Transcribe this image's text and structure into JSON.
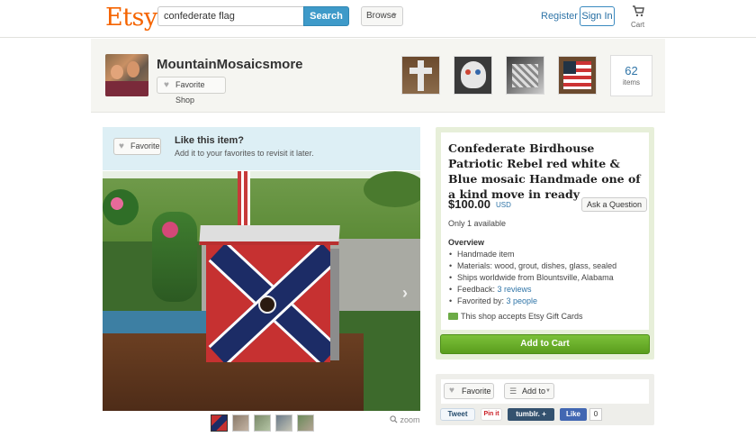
{
  "header": {
    "logo": "Etsy",
    "search_value": "confederate flag",
    "search_button": "Search",
    "browse_label": "Browse",
    "register": "Register",
    "signin": "Sign In",
    "cart_label": "Cart"
  },
  "shop": {
    "name": "MountainMosaicsmore",
    "favorite_shop": "Favorite Shop",
    "items_count": "62",
    "items_label": "items"
  },
  "favorite_prompt": {
    "button": "Favorite",
    "title": "Like this item?",
    "subtitle": "Add it to your favorites to revisit it later."
  },
  "image": {
    "zoom": "zoom"
  },
  "listing": {
    "title": "Confederate Birdhouse Patriotic Rebel red white & Blue mosaic Handmade one of a kind move in ready",
    "price": "$100.00",
    "currency": "USD",
    "ask_question": "Ask a Question",
    "availability": "Only 1 available",
    "overview_title": "Overview",
    "overview": {
      "handmade": "Handmade item",
      "materials": "Materials: wood, grout, dishes, glass, sealed",
      "ships": "Ships worldwide from Blountsville, Alabama",
      "feedback_prefix": "Feedback: ",
      "feedback_link": "3 reviews",
      "favorited_prefix": "Favorited by: ",
      "favorited_link": "3 people"
    },
    "gift_cards": "This shop accepts Etsy Gift Cards",
    "add_to_cart": "Add to Cart"
  },
  "social": {
    "favorite": "Favorite",
    "add_to": "Add to",
    "tweet": "Tweet",
    "pinit": "Pin it",
    "tumblr": "tumblr. +",
    "like": "Like",
    "like_count": "0"
  },
  "colors": {
    "brand": "#f56400",
    "link": "#3075a8",
    "search_button": "#3e9ac9",
    "add_to_cart": "#6aaf2a",
    "prompt_bg": "#ddeff5",
    "listing_bg": "#e7efd9"
  },
  "icons": {
    "cart": "cart-icon",
    "heart": "heart-icon",
    "caret": "chevron-down-icon",
    "next": "chevron-right-icon",
    "zoom": "magnifier-icon",
    "gift": "gift-card-icon",
    "list": "list-icon"
  }
}
